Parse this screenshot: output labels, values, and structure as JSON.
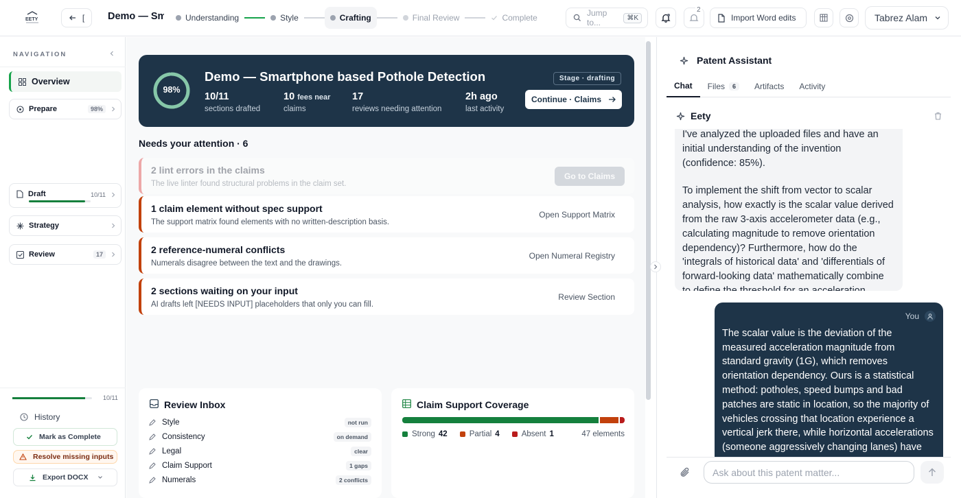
{
  "topbar": {
    "back_label": "[",
    "doc_title": "Demo — Smartphone based Pothole Detection",
    "steps": [
      {
        "label": "Understanding"
      },
      {
        "label": "Style"
      },
      {
        "label": "Crafting"
      },
      {
        "label": "Final Review"
      },
      {
        "label": "Complete"
      }
    ],
    "jump_placeholder": "Jump to...",
    "jump_shortcut": "⌘K",
    "notification_count": "2",
    "import_label": "Import Word edits",
    "user_name": "Tabrez Alam"
  },
  "sidebar": {
    "nav_label": "NAVIGATION",
    "overview": "Overview",
    "prepare": {
      "label": "Prepare",
      "value": "98%"
    },
    "draft": {
      "label": "Draft",
      "value": "10/11",
      "progress": 0.91
    },
    "strategy": {
      "label": "Strategy"
    },
    "review": {
      "label": "Review",
      "value": "17"
    },
    "overall_progress": 0.91,
    "overall_label": "10/11",
    "history": "History",
    "mark_complete": "Mark as Complete",
    "resolve_missing": "Resolve missing inputs",
    "export": "Export DOCX"
  },
  "hero": {
    "percent": "98%",
    "percent_value": 0.98,
    "title": "Demo — Smartphone based Pothole Detection",
    "stage": "Stage · drafting",
    "stats": [
      {
        "num": "10/11",
        "label": "sections drafted",
        "sub": ""
      },
      {
        "num": "10",
        "label": "claims",
        "sub": "fees near"
      },
      {
        "num": "17",
        "label": "reviews needing attention",
        "sub": ""
      },
      {
        "num": "2h ago",
        "label": "last activity",
        "sub": ""
      }
    ],
    "continue_label": "Continue · Claims"
  },
  "attention": {
    "title": "Needs your attention · 6",
    "items": [
      {
        "title": "2 lint errors in the claims",
        "desc": "The live linter found structural problems in the claim set.",
        "action": "Go to Claims"
      },
      {
        "title": "1 claim element without spec support",
        "desc": "The support matrix found elements with no written-description basis.",
        "action": "Open Support Matrix"
      },
      {
        "title": "2 reference-numeral conflicts",
        "desc": "Numerals disagree between the text and the drawings.",
        "action": "Open Numeral Registry"
      },
      {
        "title": "2 sections waiting on your input",
        "desc": "AI drafts left [NEEDS INPUT] placeholders that only you can fill.",
        "action": "Review Section"
      }
    ]
  },
  "inbox": {
    "title": "Review Inbox",
    "rows": [
      {
        "label": "Style",
        "tag": "not run"
      },
      {
        "label": "Consistency",
        "tag": "on demand"
      },
      {
        "label": "Legal",
        "tag": "clear"
      },
      {
        "label": "Claim Support",
        "tag": "1 gaps"
      },
      {
        "label": "Numerals",
        "tag": "2 conflicts"
      }
    ]
  },
  "coverage": {
    "title": "Claim Support Coverage",
    "strong": {
      "label": "Strong",
      "value": 42,
      "value_text": "42",
      "color": "#15803d"
    },
    "partial": {
      "label": "Partial",
      "value": 4,
      "value_text": "4",
      "color": "#c2410c"
    },
    "absent": {
      "label": "Absent",
      "value": 1,
      "value_text": "1",
      "color": "#b91c1c"
    },
    "total_label": "47 elements"
  },
  "assistant": {
    "title": "Patent Assistant",
    "tabs": [
      {
        "label": "Chat"
      },
      {
        "label": "Files",
        "count": "6"
      },
      {
        "label": "Artifacts"
      },
      {
        "label": "Activity"
      }
    ],
    "bot_name": "Eety",
    "bot_message_1": "I've analyzed the uploaded files and have an initial understanding of the invention (confidence: 85%).",
    "bot_message_2": "To implement the shift from vector to scalar analysis, how exactly is the scalar value derived from the raw 3-axis accelerometer data (e.g., calculating magnitude to remove orientation dependency)? Furthermore, how do the 'integrals of historical data' and 'differentials of forward-looking data' mathematically combine to define the threshold for an acceleration spike?",
    "user_label": "You",
    "user_message": "The scalar value is the deviation of the measured acceleration magnitude from standard gravity (1G), which removes orientation dependency. Ours is a statistical method: potholes, speed bumps and bad patches are static in location, so the majority of vehicles crossing that location experience a vertical jerk there, while horizontal accelerations (someone aggressively changing lanes) have no location pattern - the crowd statistics automatically reveal the events. To account for",
    "input_placeholder": "Ask about this patent matter..."
  }
}
